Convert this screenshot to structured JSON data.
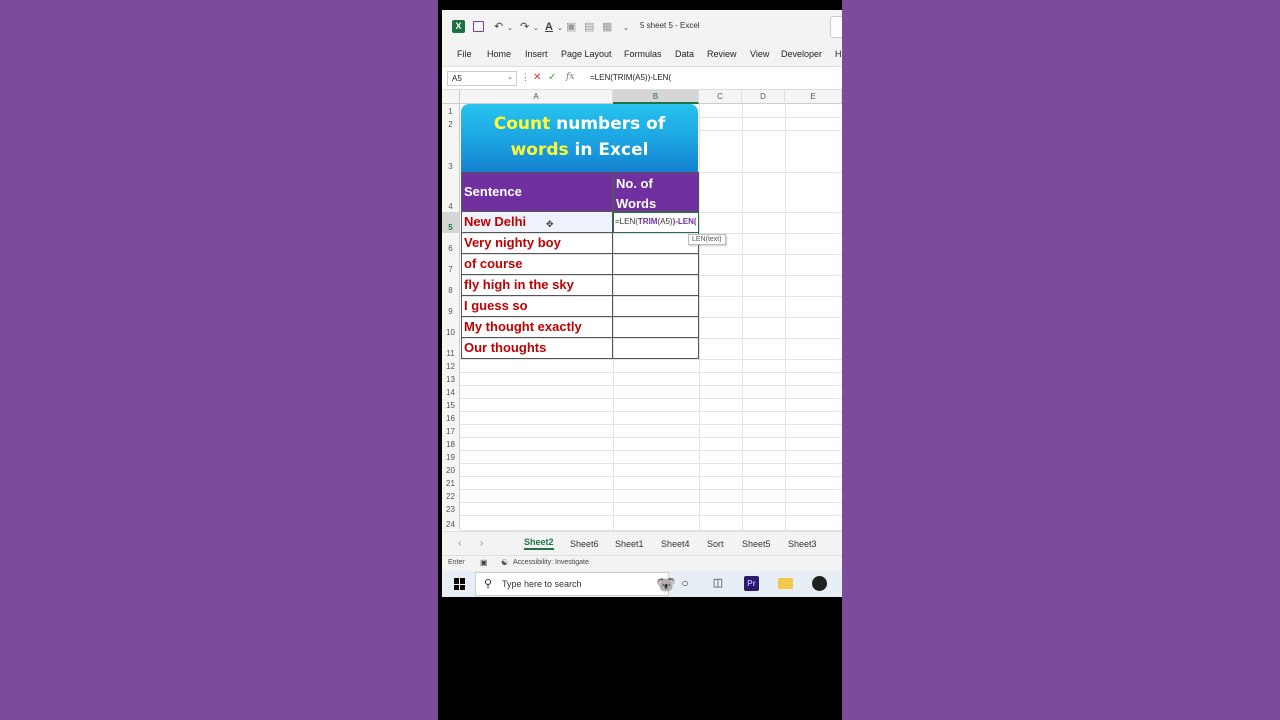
{
  "window": {
    "title": "5 sheet 5  -  Excel",
    "logo_text": "X"
  },
  "ribbon": {
    "tabs": [
      "File",
      "Home",
      "Insert",
      "Page Layout",
      "Formulas",
      "Data",
      "Review",
      "View",
      "Developer",
      "H"
    ]
  },
  "formula_bar": {
    "name_box": "A5",
    "fx_label": "fx",
    "formula": "=LEN(TRIM(A5))-LEN("
  },
  "columns": [
    "A",
    "B",
    "C",
    "D",
    "E"
  ],
  "rows": [
    "1",
    "2",
    "3",
    "4",
    "5",
    "6",
    "7",
    "8",
    "9",
    "10",
    "11",
    "12",
    "13",
    "14",
    "15",
    "16",
    "17",
    "18",
    "19",
    "20",
    "21",
    "22",
    "23",
    "24"
  ],
  "banner": {
    "line1_highlight": "Count",
    "line1_rest": " numbers of",
    "line2_highlight": "words",
    "line2_rest": " in Excel"
  },
  "table": {
    "header_a": "Sentence",
    "header_b_line1": "No. of",
    "header_b_line2": "Words",
    "sentences": [
      "New Delhi",
      "Very nighty boy",
      "of course",
      "fly high in the sky",
      "I guess so",
      "My thought exactly",
      "Our thoughts"
    ]
  },
  "edit_cell": {
    "prefix": "=LEN(",
    "fn": "TRIM",
    "arg": "(A5)",
    "suffix": ")-LEN(",
    "tooltip": "LEN(text)"
  },
  "sheet_tabs": [
    "Sheet2",
    "Sheet6",
    "Sheet1",
    "Sheet4",
    "Sort",
    "Sheet5",
    "Sheet3"
  ],
  "status": {
    "mode": "Enter",
    "accessibility": "Accessibility: Investigate"
  },
  "taskbar": {
    "search_placeholder": "Type here to search",
    "premiere_label": "Pr"
  },
  "colors": {
    "background": "#7b4c9a",
    "header_purple": "#7030a0",
    "sentence_red": "#c00000",
    "banner_blue": "#1aa0e0",
    "banner_yellow": "#ffff33",
    "excel_green": "#217346"
  }
}
